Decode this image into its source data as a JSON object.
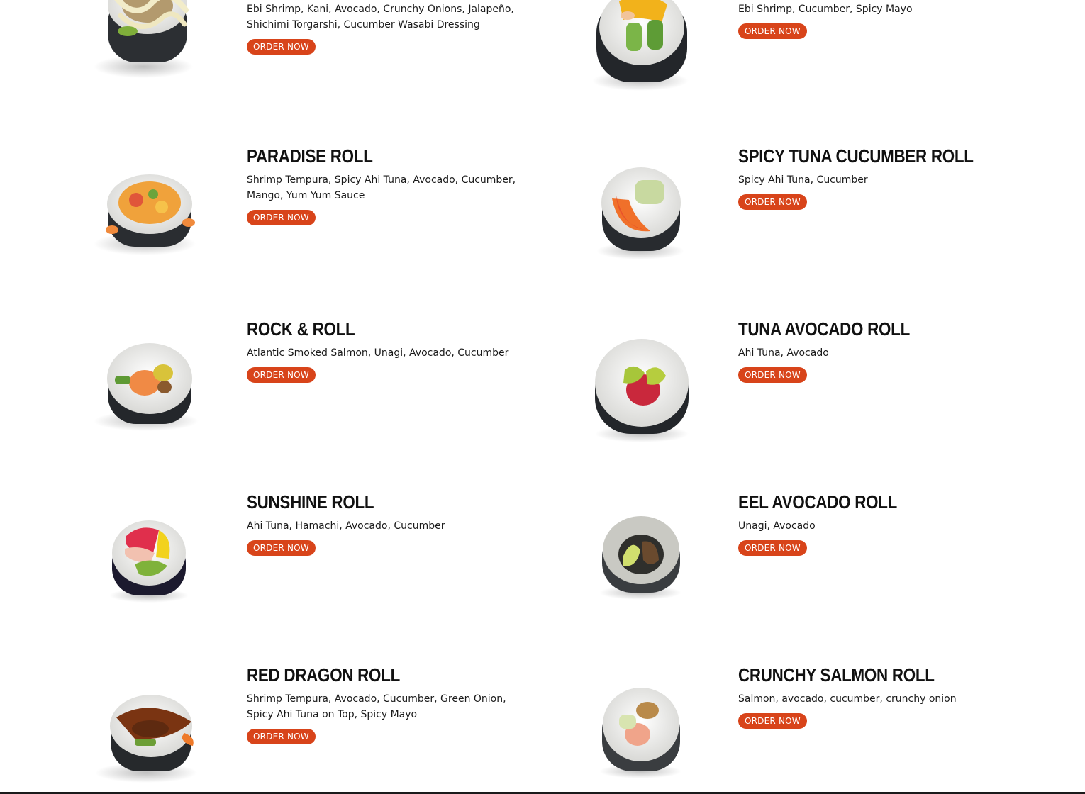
{
  "accent_color": "#d8441a",
  "menu": {
    "order_label": "ORDER NOW",
    "items": [
      {
        "name": "",
        "description": "Ebi Shrimp, Kani, Avocado, Crunchy Onions, Jalapeño, Shichimi Torgarshi, Cucumber Wasabi Dressing",
        "image_icon": "sushi-roll-image"
      },
      {
        "name": "",
        "description": "Ebi Shrimp, Cucumber, Spicy Mayo",
        "image_icon": "sushi-roll-image"
      },
      {
        "name": "PARADISE ROLL",
        "description": "Shrimp Tempura, Spicy Ahi Tuna, Avocado, Cucumber, Mango, Yum Yum Sauce",
        "image_icon": "sushi-roll-image"
      },
      {
        "name": "SPICY TUNA CUCUMBER ROLL",
        "description": "Spicy Ahi Tuna, Cucumber",
        "image_icon": "sushi-roll-image"
      },
      {
        "name": "ROCK & ROLL",
        "description": "Atlantic Smoked Salmon, Unagi, Avocado, Cucumber",
        "image_icon": "sushi-roll-image"
      },
      {
        "name": "TUNA AVOCADO ROLL",
        "description": "Ahi Tuna, Avocado",
        "image_icon": "sushi-roll-image"
      },
      {
        "name": "SUNSHINE ROLL",
        "description": "Ahi Tuna, Hamachi, Avocado, Cucumber",
        "image_icon": "sushi-roll-image"
      },
      {
        "name": "EEL AVOCADO ROLL",
        "description": "Unagi, Avocado",
        "image_icon": "sushi-roll-image"
      },
      {
        "name": "RED DRAGON ROLL",
        "description": "Shrimp Tempura, Avocado, Cucumber, Green Onion, Spicy Ahi Tuna on Top, Spicy Mayo",
        "image_icon": "sushi-roll-image"
      },
      {
        "name": "CRUNCHY SALMON ROLL",
        "description": "Salmon, avocado, cucumber, crunchy onion",
        "image_icon": "sushi-roll-image"
      }
    ]
  }
}
